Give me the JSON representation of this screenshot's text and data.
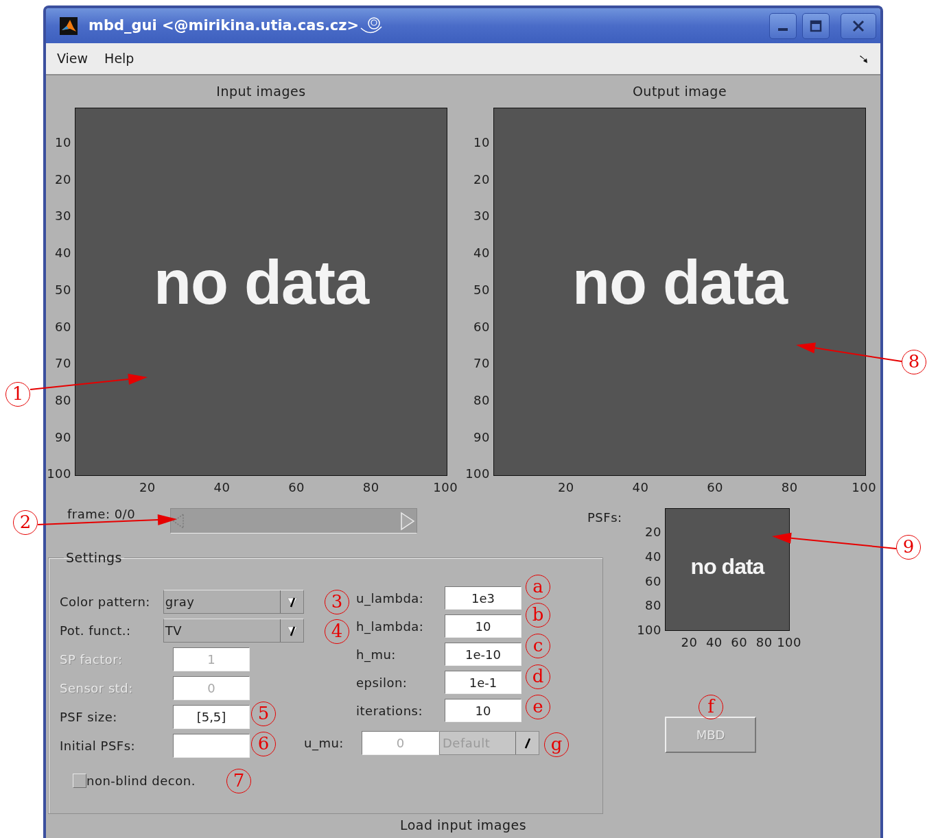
{
  "window": {
    "title": "mbd_gui <@mirikina.utia.cas.cz>"
  },
  "menu": [
    {
      "label": "View"
    },
    {
      "label": "Help"
    }
  ],
  "axes": [
    {
      "title": "Input images",
      "yticks": [
        "10",
        "20",
        "30",
        "40",
        "50",
        "60",
        "70",
        "80",
        "90",
        "100"
      ],
      "xticks": [
        "20",
        "40",
        "60",
        "80",
        "100"
      ],
      "image_text": "no data"
    },
    {
      "title": "Output image",
      "yticks": [
        "10",
        "20",
        "30",
        "40",
        "50",
        "60",
        "70",
        "80",
        "90",
        "100"
      ],
      "xticks": [
        "20",
        "40",
        "60",
        "80",
        "100"
      ],
      "image_text": "no data"
    }
  ],
  "frame_slider": {
    "label": "frame: 0/0",
    "disabled": true
  },
  "settings": {
    "title": "Settings",
    "controls": [
      {
        "kind": "dropdown",
        "label": "Color pattern:",
        "value": "gray",
        "disabled": false
      },
      {
        "kind": "dropdown",
        "label": "Pot. funct.:",
        "value": "TV",
        "disabled": false
      },
      {
        "kind": "field",
        "label": "SP factor:",
        "value": "1",
        "disabled": true
      },
      {
        "kind": "field",
        "label": "Sensor std:",
        "value": "0",
        "disabled": true
      },
      {
        "kind": "field",
        "label": "PSF size:",
        "value": "[5,5]",
        "disabled": false
      },
      {
        "kind": "field",
        "label": "Initial PSFs:",
        "disabled": false
      }
    ],
    "checkbox": {
      "label": "non-blind decon.",
      "checked": false
    },
    "params": [
      {
        "label": "u_lambda:",
        "value": "1e3"
      },
      {
        "label": "h_lambda:",
        "value": "10"
      },
      {
        "label": "h_mu:",
        "value": "1e-10"
      },
      {
        "label": "epsilon:",
        "value": "1e-1"
      },
      {
        "label": "iterations:",
        "value": "10"
      }
    ],
    "u_mu": {
      "label": "u_mu:",
      "value": "0",
      "option": "Default",
      "disabled": true
    }
  },
  "psfs": {
    "label": "PSFs:",
    "yticks": [
      "20",
      "40",
      "60",
      "80",
      "100"
    ],
    "xticks": [
      "20",
      "40",
      "60",
      "80",
      "100"
    ],
    "image_text": "no data"
  },
  "mbd_button": {
    "label": "MBD",
    "disabled": true
  },
  "status": "Load input images",
  "annotations": [
    {
      "label": "1"
    },
    {
      "label": "2"
    },
    {
      "label": "3"
    },
    {
      "label": "4"
    },
    {
      "label": "5"
    },
    {
      "label": "6"
    },
    {
      "label": "7"
    },
    {
      "label": "8"
    },
    {
      "label": "9"
    },
    {
      "label": "a"
    },
    {
      "label": "b"
    },
    {
      "label": "c"
    },
    {
      "label": "d"
    },
    {
      "label": "e"
    },
    {
      "label": "f"
    },
    {
      "label": "g"
    }
  ]
}
